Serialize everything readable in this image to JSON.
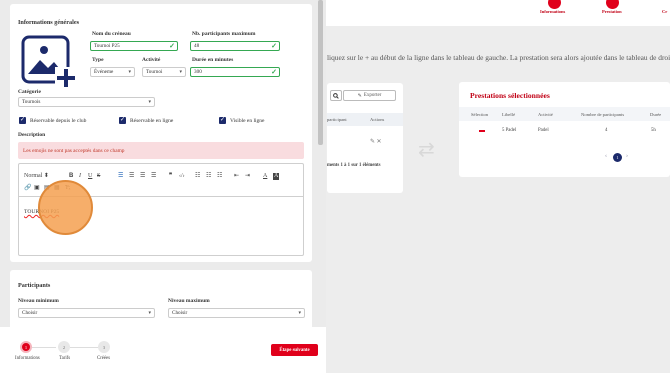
{
  "background": {
    "steps": [
      {
        "label": "Informations"
      },
      {
        "label": "Prestation"
      },
      {
        "label": "Cr"
      }
    ],
    "instruction": "liquez sur le + au début de la ligne dans le tableau de gauche. La prestation sera alors ajoutée dans le tableau de droite. Vo",
    "left_table": {
      "export_label": "Exporter",
      "headers": [
        "participant",
        "Actions"
      ],
      "footer": "ments 1 à 1 sur 1 éléments"
    },
    "selected_services": {
      "title": "Prestations sélectionnées",
      "headers": [
        "Sélection",
        "Libellé",
        "Activité",
        "Nombre de participants",
        "Durée"
      ],
      "row": {
        "libelle": "5 Padel",
        "activite": "Padel",
        "participants": "4",
        "duree": "5h"
      },
      "page": "1"
    }
  },
  "general": {
    "section_title": "Informations générales",
    "slot_name": {
      "label": "Nom du créneau",
      "value": "Tournoi P25"
    },
    "max_participants": {
      "label": "Nb. participants maximum",
      "value": "48"
    },
    "type": {
      "label": "Type",
      "value": "Événeme"
    },
    "activity": {
      "label": "Activité",
      "value": "Tournoi"
    },
    "duration": {
      "label": "Durée en minutes",
      "value": "300"
    },
    "category": {
      "label": "Catégorie",
      "value": "Tournois"
    },
    "checkboxes": [
      {
        "label": "Réservable depuis le club",
        "checked": true
      },
      {
        "label": "Réservable en ligne",
        "checked": true
      },
      {
        "label": "Visible en ligne",
        "checked": true
      }
    ],
    "description": {
      "label": "Description",
      "error": "Les emojis ne sont pas acceptés dans ce champ",
      "format_select": "Normal",
      "content": "TOURNOI P25"
    }
  },
  "participants": {
    "section_title": "Participants",
    "min_level": {
      "label": "Niveau minimum",
      "value": "Choisir"
    },
    "max_level": {
      "label": "Niveau maximum",
      "value": "Choisir"
    }
  },
  "stepper": {
    "steps": [
      {
        "number": "1",
        "label": "Informations",
        "active": true
      },
      {
        "number": "2",
        "label": "Tarifs",
        "active": false
      },
      {
        "number": "3",
        "label": "Créées",
        "active": false
      }
    ],
    "next_label": "Étape suivante"
  },
  "colors": {
    "accent": "#e0001b",
    "navy": "#1c2a6b",
    "valid": "#35a852",
    "error_bg": "#f9dcdf"
  }
}
